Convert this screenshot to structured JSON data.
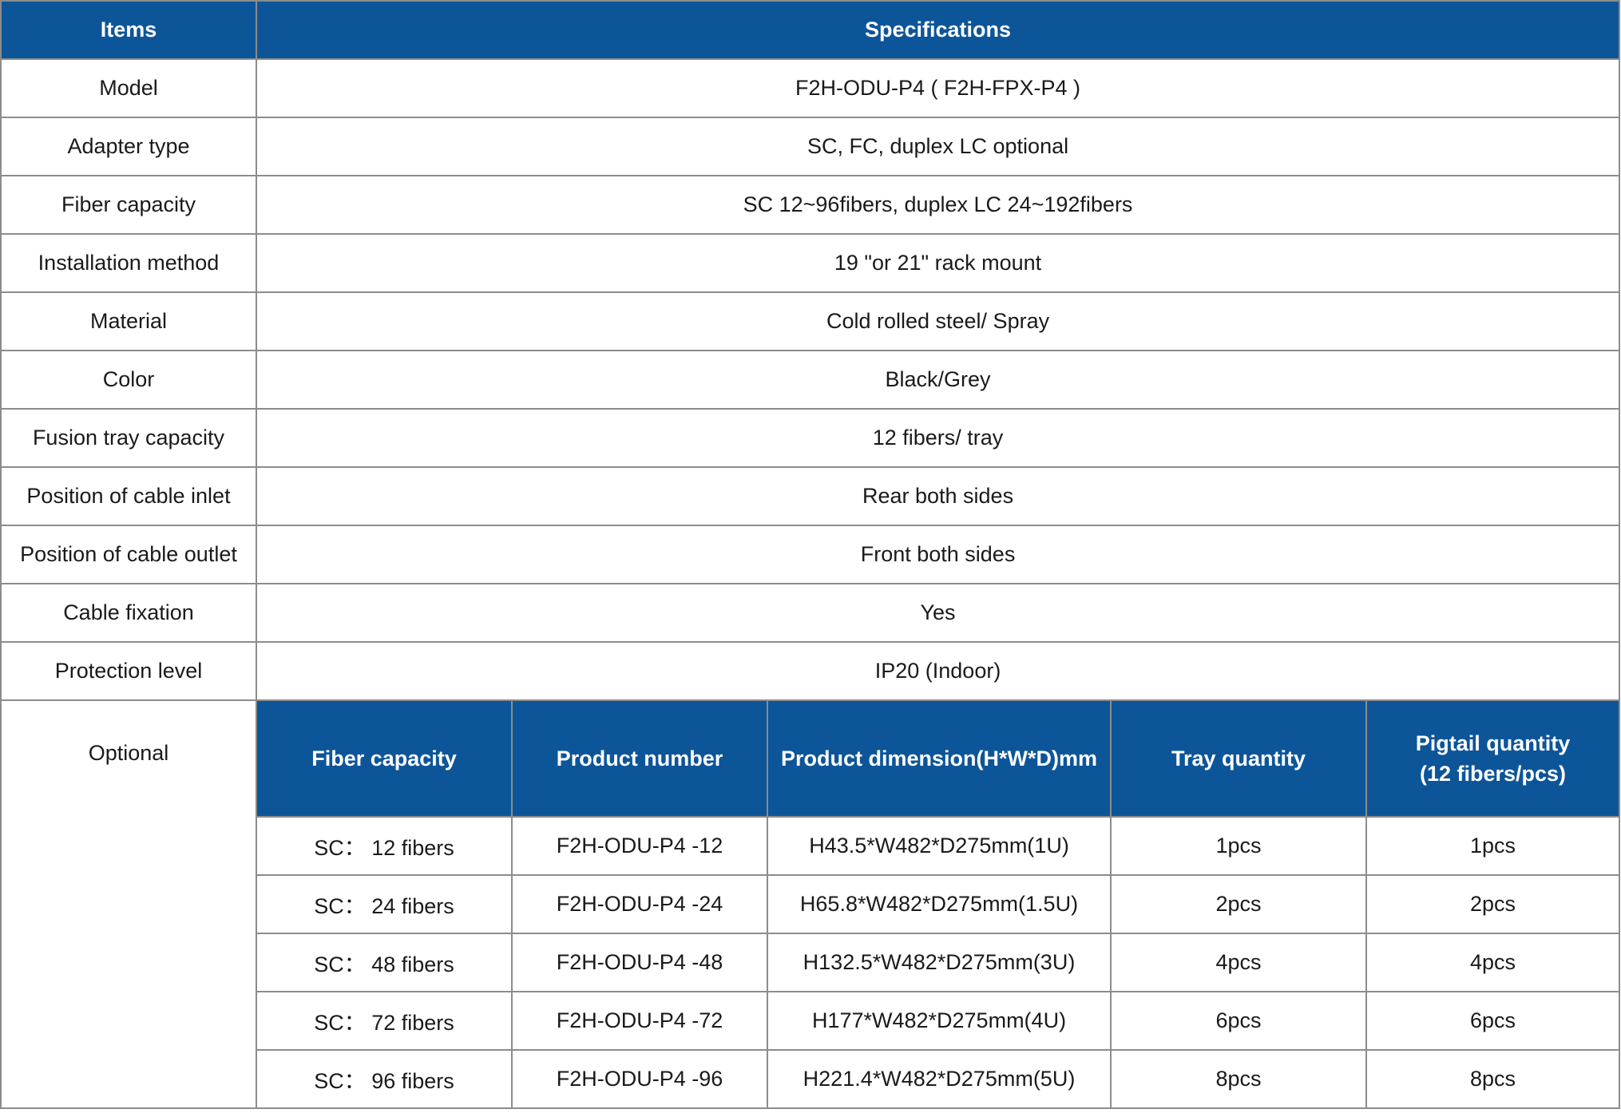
{
  "header": {
    "items": "Items",
    "specifications": "Specifications"
  },
  "rows": [
    {
      "item": "Model",
      "spec": "F2H-ODU-P4 ( F2H-FPX-P4 )"
    },
    {
      "item": "Adapter type",
      "spec": "SC, FC, duplex LC optional"
    },
    {
      "item": "Fiber capacity",
      "spec": "SC 12~96fibers,  duplex LC  24~192fibers"
    },
    {
      "item": "Installation method",
      "spec": "19 \"or 21\" rack mount"
    },
    {
      "item": "Material",
      "spec": "Cold rolled steel/ Spray"
    },
    {
      "item": "Color",
      "spec": "Black/Grey"
    },
    {
      "item": "Fusion tray capacity",
      "spec": "12 fibers/ tray"
    },
    {
      "item": "Position of cable inlet",
      "spec": "Rear both sides"
    },
    {
      "item": "Position of cable outlet",
      "spec": "Front both sides"
    },
    {
      "item": "Cable fixation",
      "spec": "Yes"
    },
    {
      "item": "Protection level",
      "spec": "IP20 (Indoor)"
    }
  ],
  "optional": {
    "label": "Optional",
    "columns": [
      "Fiber capacity",
      "Product number",
      "Product dimension(H*W*D)mm",
      "Tray quantity",
      "Pigtail quantity"
    ],
    "pigtail_sub": "(12 fibers/pcs)",
    "rows": [
      [
        "SC： 12 fibers",
        "F2H-ODU-P4 -12",
        "H43.5*W482*D275mm(1U)",
        "1pcs",
        "1pcs"
      ],
      [
        "SC： 24 fibers",
        "F2H-ODU-P4 -24",
        "H65.8*W482*D275mm(1.5U)",
        "2pcs",
        "2pcs"
      ],
      [
        "SC： 48 fibers",
        "F2H-ODU-P4 -48",
        "H132.5*W482*D275mm(3U)",
        "4pcs",
        "4pcs"
      ],
      [
        "SC： 72 fibers",
        "F2H-ODU-P4 -72",
        "H177*W482*D275mm(4U)",
        "6pcs",
        "6pcs"
      ],
      [
        "SC： 96 fibers",
        "F2H-ODU-P4 -96",
        "H221.4*W482*D275mm(5U)",
        "8pcs",
        "8pcs"
      ]
    ]
  },
  "colors": {
    "header_bg": "#0d5599",
    "header_text": "#ffffff",
    "border": "#8c8c8c"
  }
}
